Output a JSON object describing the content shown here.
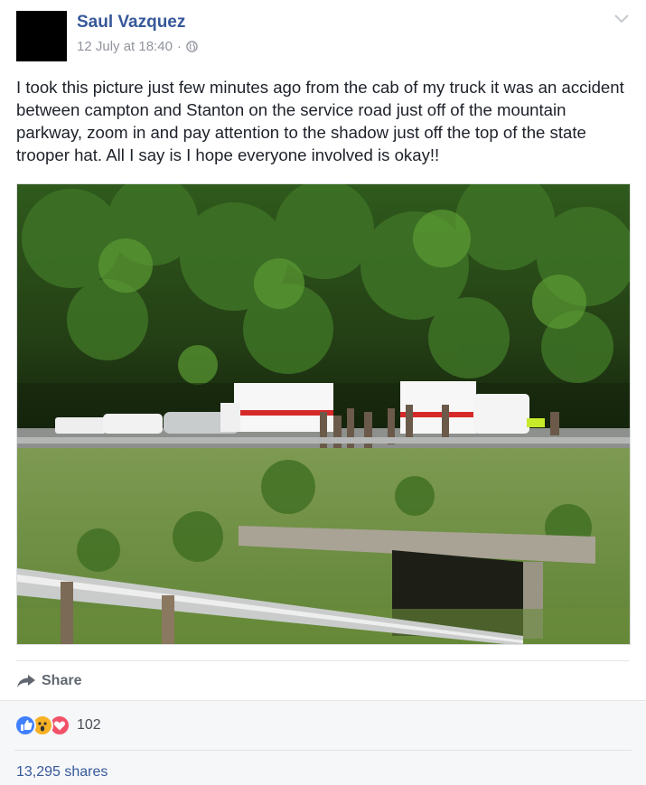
{
  "post": {
    "author": "Saul Vazquez",
    "timestamp": "12 July at 18:40",
    "separator": "·",
    "audience_icon": "globe-icon",
    "menu_icon": "chevron-down-icon",
    "text": "I took this picture just few minutes ago from the cab of my truck it was an accident between campton and Stanton on the service road just off of the mountain parkway, zoom in and pay attention to the shadow just off the top of the state trooper hat. All I say is I hope everyone involved is okay!!"
  },
  "actions": {
    "share_label": "Share",
    "share_icon": "share-arrow-icon"
  },
  "engagement": {
    "reaction_icons": [
      "like-icon",
      "wow-icon",
      "love-icon"
    ],
    "reaction_count": "102",
    "shares": "13,295 shares"
  },
  "colors": {
    "link": "#365899",
    "meta": "#90949c",
    "like": "#4080ff",
    "wow": "#f7b125",
    "love": "#f25268"
  }
}
